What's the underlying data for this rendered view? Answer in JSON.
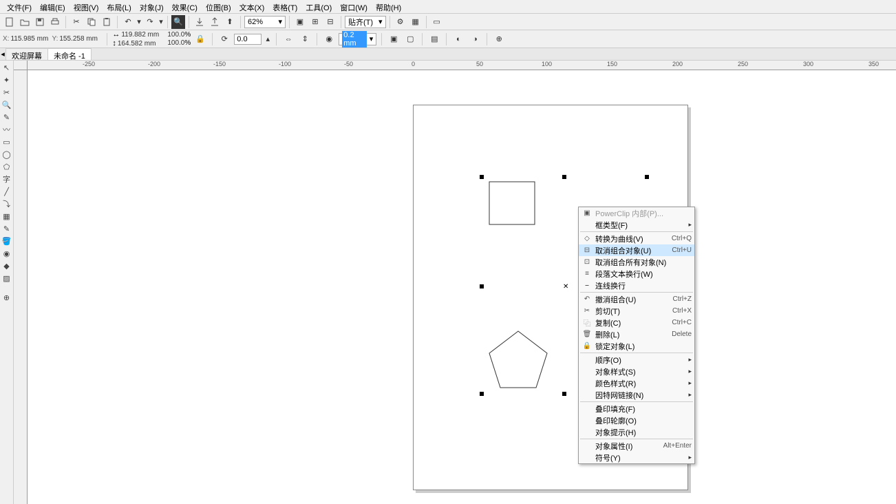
{
  "menubar": [
    "文件(F)",
    "编辑(E)",
    "视图(V)",
    "布局(L)",
    "对象(J)",
    "效果(C)",
    "位图(B)",
    "文本(X)",
    "表格(T)",
    "工具(O)",
    "窗口(W)",
    "帮助(H)"
  ],
  "zoom": "62%",
  "coords": {
    "x": "115.985 mm",
    "y": "155.258 mm"
  },
  "size": {
    "w": "119.882 mm",
    "h": "164.582 mm"
  },
  "scale": {
    "x": "100.0",
    "y": "100.0"
  },
  "rotation": "0.0",
  "outline": "0.2 mm",
  "tabs": [
    "欢迎屏幕",
    "未命名 -1"
  ],
  "ruler_h": [
    "-250",
    "-200",
    "-150",
    "-100",
    "-50",
    "0",
    "50",
    "100",
    "150",
    "200",
    "250",
    "300",
    "350"
  ],
  "ctx": [
    {
      "icon": "pc",
      "label": "PowerClip 内部(P)...",
      "disabled": true
    },
    {
      "label": "框类型(F)",
      "sub": true
    },
    "sep",
    {
      "icon": "cv",
      "label": "转换为曲线(V)",
      "short": "Ctrl+Q"
    },
    {
      "icon": "ug",
      "label": "取消组合对象(U)",
      "short": "Ctrl+U",
      "hl": true
    },
    {
      "icon": "ua",
      "label": "取消组合所有对象(N)"
    },
    {
      "icon": "wr",
      "label": "段落文本换行(W)"
    },
    {
      "icon": "ln",
      "label": "连线换行"
    },
    "sep",
    {
      "icon": "un",
      "label": "撤消组合(U)",
      "short": "Ctrl+Z"
    },
    {
      "icon": "ct",
      "label": "剪切(T)",
      "short": "Ctrl+X"
    },
    {
      "icon": "cp",
      "label": "复制(C)",
      "short": "Ctrl+C"
    },
    {
      "icon": "dl",
      "label": "删除(L)",
      "short": "Delete"
    },
    {
      "icon": "lk",
      "label": "锁定对象(L)"
    },
    "sep",
    {
      "label": "顺序(O)",
      "sub": true
    },
    {
      "label": "对象样式(S)",
      "sub": true
    },
    {
      "label": "颜色样式(R)",
      "sub": true
    },
    {
      "label": "因特网链接(N)",
      "sub": true
    },
    "sep",
    {
      "label": "叠印填充(F)"
    },
    {
      "label": "叠印轮廓(O)"
    },
    {
      "label": "对象提示(H)"
    },
    "sep",
    {
      "label": "对象属性(I)",
      "short": "Alt+Enter"
    },
    {
      "label": "符号(Y)",
      "sub": true
    }
  ]
}
